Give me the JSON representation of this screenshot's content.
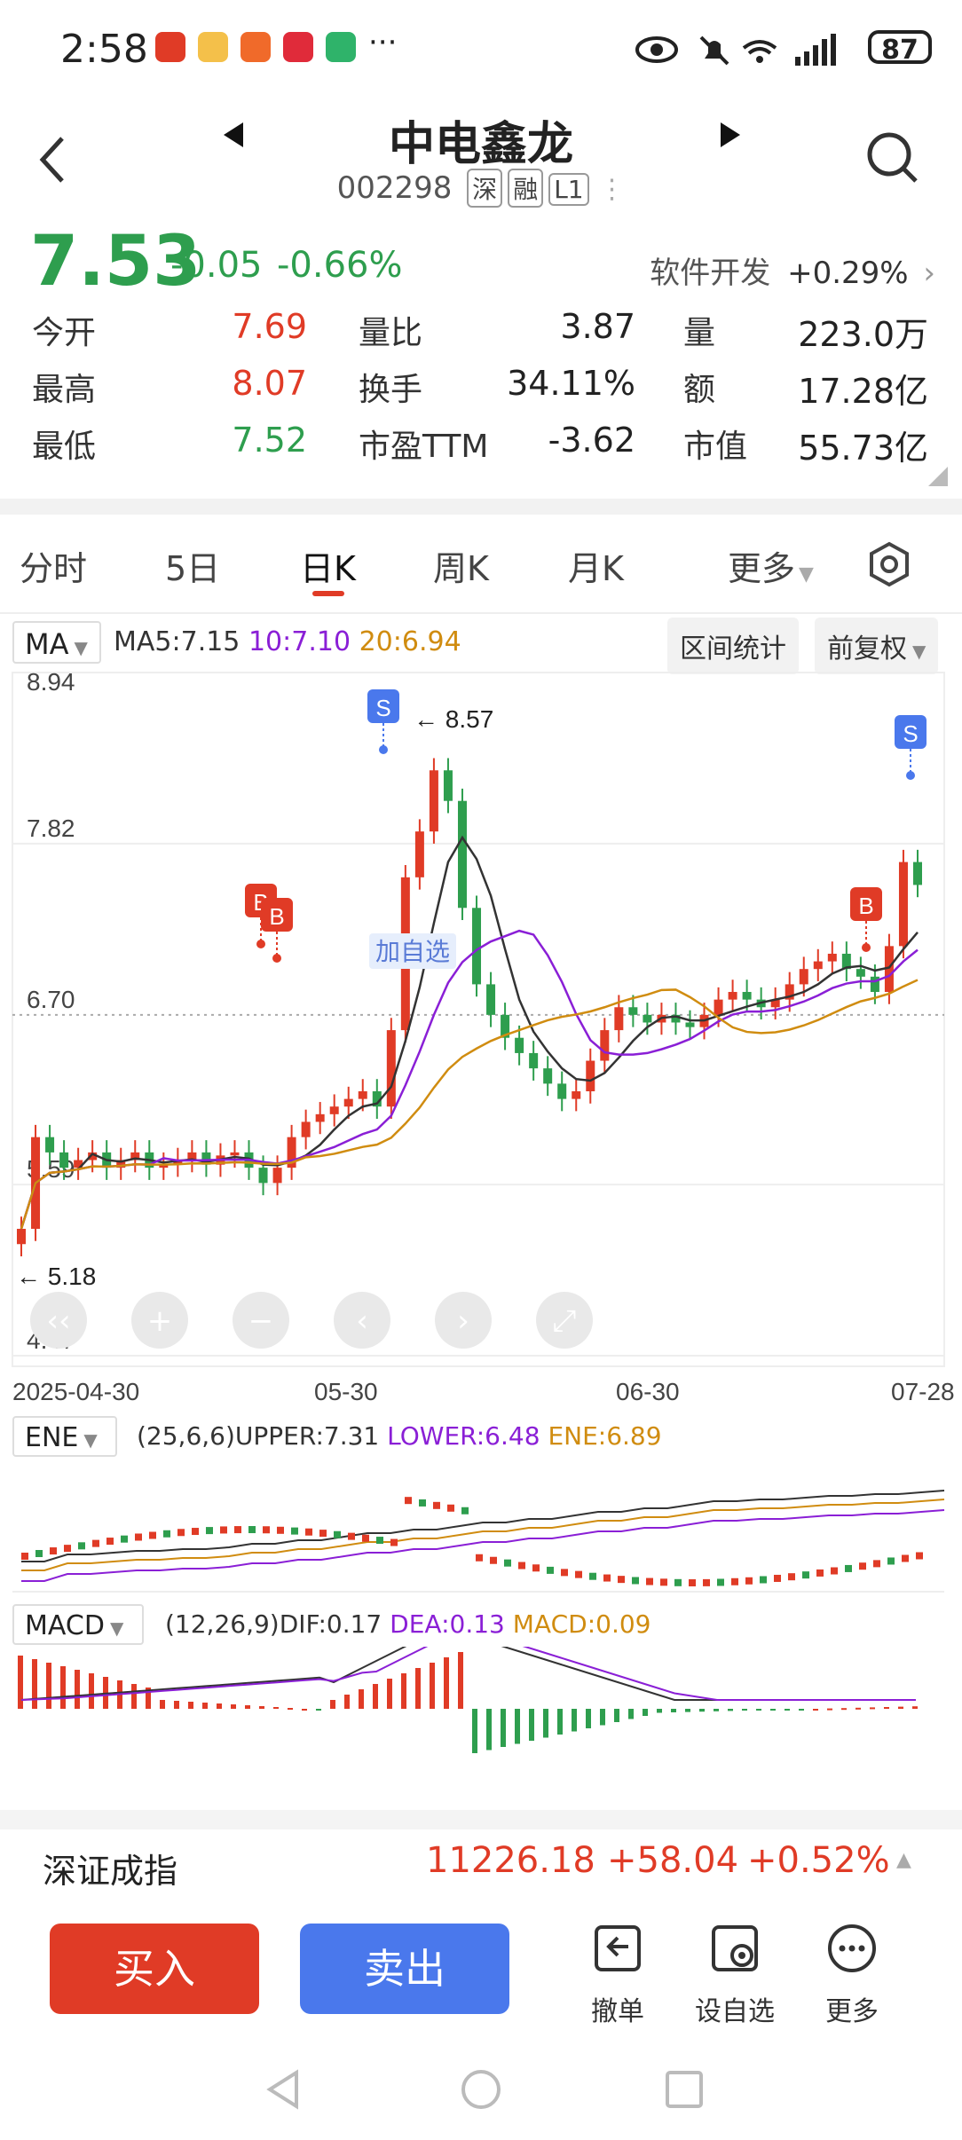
{
  "status_bar": {
    "time": "2:58",
    "battery": "87"
  },
  "header": {
    "title": "中电鑫龙",
    "code": "002298",
    "tags": [
      "深",
      "融",
      "L1"
    ]
  },
  "quote": {
    "price": "7.53",
    "change": "-0.05",
    "change_pct": "-0.66%",
    "sector_name": "软件开发",
    "sector_pct": "+0.29%",
    "rows": [
      [
        {
          "label": "今开",
          "value": "7.69",
          "color": "red"
        },
        {
          "label": "量比",
          "value": "3.87",
          "color": "dark"
        },
        {
          "label": "量",
          "value": "223.0万",
          "color": "dark"
        }
      ],
      [
        {
          "label": "最高",
          "value": "8.07",
          "color": "red"
        },
        {
          "label": "换手",
          "value": "34.11%",
          "color": "dark"
        },
        {
          "label": "额",
          "value": "17.28亿",
          "color": "dark"
        }
      ],
      [
        {
          "label": "最低",
          "value": "7.52",
          "color": "green"
        },
        {
          "label": "市盈TTM",
          "value": "-3.62",
          "color": "dark"
        },
        {
          "label": "市值",
          "value": "55.73亿",
          "color": "dark"
        }
      ]
    ]
  },
  "tabs": [
    "分时",
    "5日",
    "日K",
    "周K",
    "月K",
    "更多"
  ],
  "active_tab": "日K",
  "main_chart": {
    "indicator": "MA",
    "ma5": "MA5:7.15",
    "ma10": "10:7.10",
    "ma20": "20:6.94",
    "range_btn": "区间统计",
    "adjust_btn": "前复权",
    "y_ticks": [
      "8.94",
      "7.82",
      "6.70",
      "5.59",
      "4.47"
    ],
    "x_ticks": [
      "2025-04-30",
      "05-30",
      "06-30",
      "07-28"
    ],
    "high_label": "8.57",
    "low_label": "5.18",
    "watch_label": "加自选",
    "signal_sell": "S",
    "signal_buy": "B"
  },
  "ene": {
    "name": "ENE",
    "params": "(25,6,6)UPPER:7.31",
    "lower": "LOWER:6.48",
    "ene": "ENE:6.89"
  },
  "macd": {
    "name": "MACD",
    "params": "(12,26,9)DIF:0.17",
    "dea": "DEA:0.13",
    "macd": "MACD:0.09"
  },
  "index_bar": {
    "name": "深证成指",
    "value": "11226.18",
    "change": "+58.04",
    "pct": "+0.52%"
  },
  "actions": {
    "buy": "买入",
    "sell": "卖出",
    "cancel": "撤单",
    "watch": "设自选",
    "more": "更多"
  },
  "colors": {
    "up": "#e03b26",
    "down": "#2e9e4e",
    "ma5": "#333333",
    "ma10": "#8a1fd6",
    "ma20": "#d08c10",
    "sell_blue": "#4a78ec"
  }
}
